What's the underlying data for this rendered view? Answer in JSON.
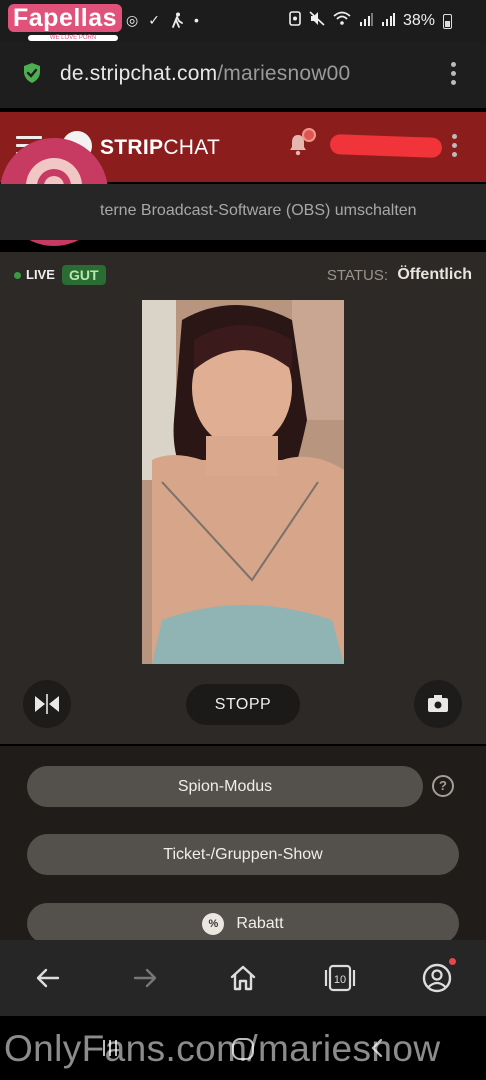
{
  "status_bar": {
    "battery": "38%"
  },
  "browser": {
    "url_host": "de.stripchat.com",
    "url_path": "/mariesnow00"
  },
  "site_header": {
    "brand_bold": "STRIP",
    "brand_thin": "CHAT"
  },
  "banner": {
    "text": "terne Broadcast-Software (OBS) umschalten"
  },
  "stream": {
    "live_label": "LIVE",
    "quality_badge": "GUT",
    "status_label": "STATUS:",
    "status_value": "Öffentlich",
    "stop_label": "STOPP"
  },
  "options": {
    "spy_mode": "Spion-Modus",
    "help_glyph": "?",
    "ticket_show": "Ticket-/Gruppen-Show",
    "discount": "Rabatt",
    "discount_icon_glyph": "%"
  },
  "bottom_nav": {
    "tabs_count": "10"
  },
  "watermarks": {
    "fapellas": "Fapellas",
    "fapellas_tagline": "WE LOVE PORN",
    "onlyfans": "OnlyFans.com/mariesnow"
  },
  "colors": {
    "header_red": "#8c1d1d",
    "live_green": "#3a9a42",
    "pill_gray": "#54504b",
    "panel_brown": "#2c2926"
  }
}
